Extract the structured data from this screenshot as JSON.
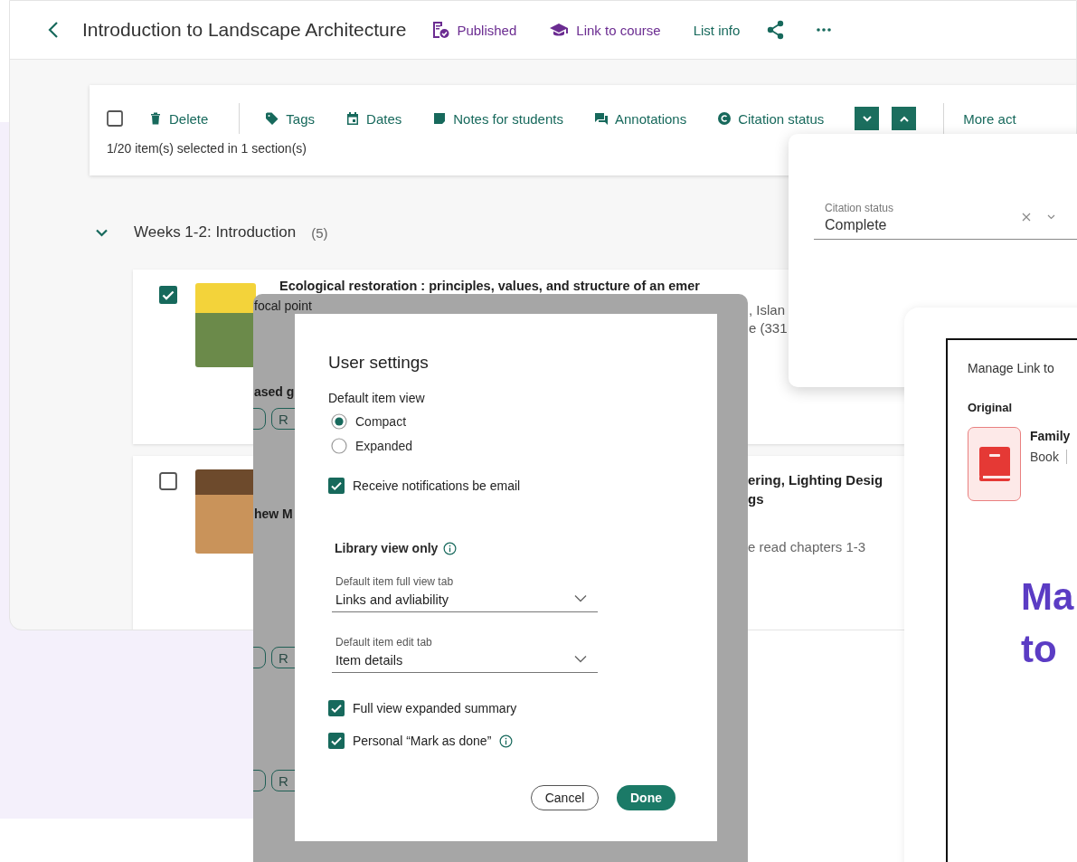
{
  "header": {
    "title": "Introduction to Landscape Architecture",
    "actions": [
      {
        "label": "Published",
        "kind": "published"
      },
      {
        "label": "Link to course",
        "kind": "course"
      },
      {
        "label": "List info",
        "kind": "plain"
      }
    ]
  },
  "toolbar": {
    "select_all_checked": false,
    "actions": [
      "Delete",
      "Tags",
      "Dates",
      "Notes for students",
      "Annotations",
      "Citation status"
    ],
    "more": "More act",
    "selection_text": "1/20 item(s) selected in 1 section(s)"
  },
  "section": {
    "title": "Weeks 1-2: Introduction",
    "count": "(5)",
    "expanded": true
  },
  "items": [
    {
      "checked": true,
      "title": "Ecological restoration : principles, values, and structure of an emer",
      "fragments": [
        ", Islan",
        "e (331"
      ]
    },
    {
      "checked": false,
      "title_fragments": [
        "ering, Lighting Desig",
        "gs"
      ],
      "note": "e read chapters 1-3"
    }
  ],
  "backdrop": {
    "fragments": [
      "focal point",
      "ased g",
      "hew M"
    ],
    "chips": [
      "R",
      "R",
      "R"
    ]
  },
  "citation_popup": {
    "label": "Citation status",
    "value": "Complete"
  },
  "user_settings": {
    "title": "User settings",
    "view_label": "Default item view",
    "view_options": [
      {
        "label": "Compact",
        "selected": true
      },
      {
        "label": "Expanded",
        "selected": false
      }
    ],
    "notifications": {
      "label": "Receive notifications be email",
      "checked": true
    },
    "library_title": "Library view only",
    "selects": [
      {
        "label": "Default item full view tab",
        "value": "Links and avliability"
      },
      {
        "label": "Default item edit tab",
        "value": "Item details"
      }
    ],
    "options": [
      {
        "label": "Full view expanded summary",
        "checked": true,
        "info": false
      },
      {
        "label": "Personal “Mark as done”",
        "checked": true,
        "info": true
      }
    ],
    "buttons": {
      "cancel": "Cancel",
      "done": "Done"
    }
  },
  "manage_link": {
    "title": "Manage Link to",
    "section": "Original",
    "item_title": "Family",
    "item_type": "Book",
    "headline": [
      "Ma",
      "to"
    ]
  }
}
